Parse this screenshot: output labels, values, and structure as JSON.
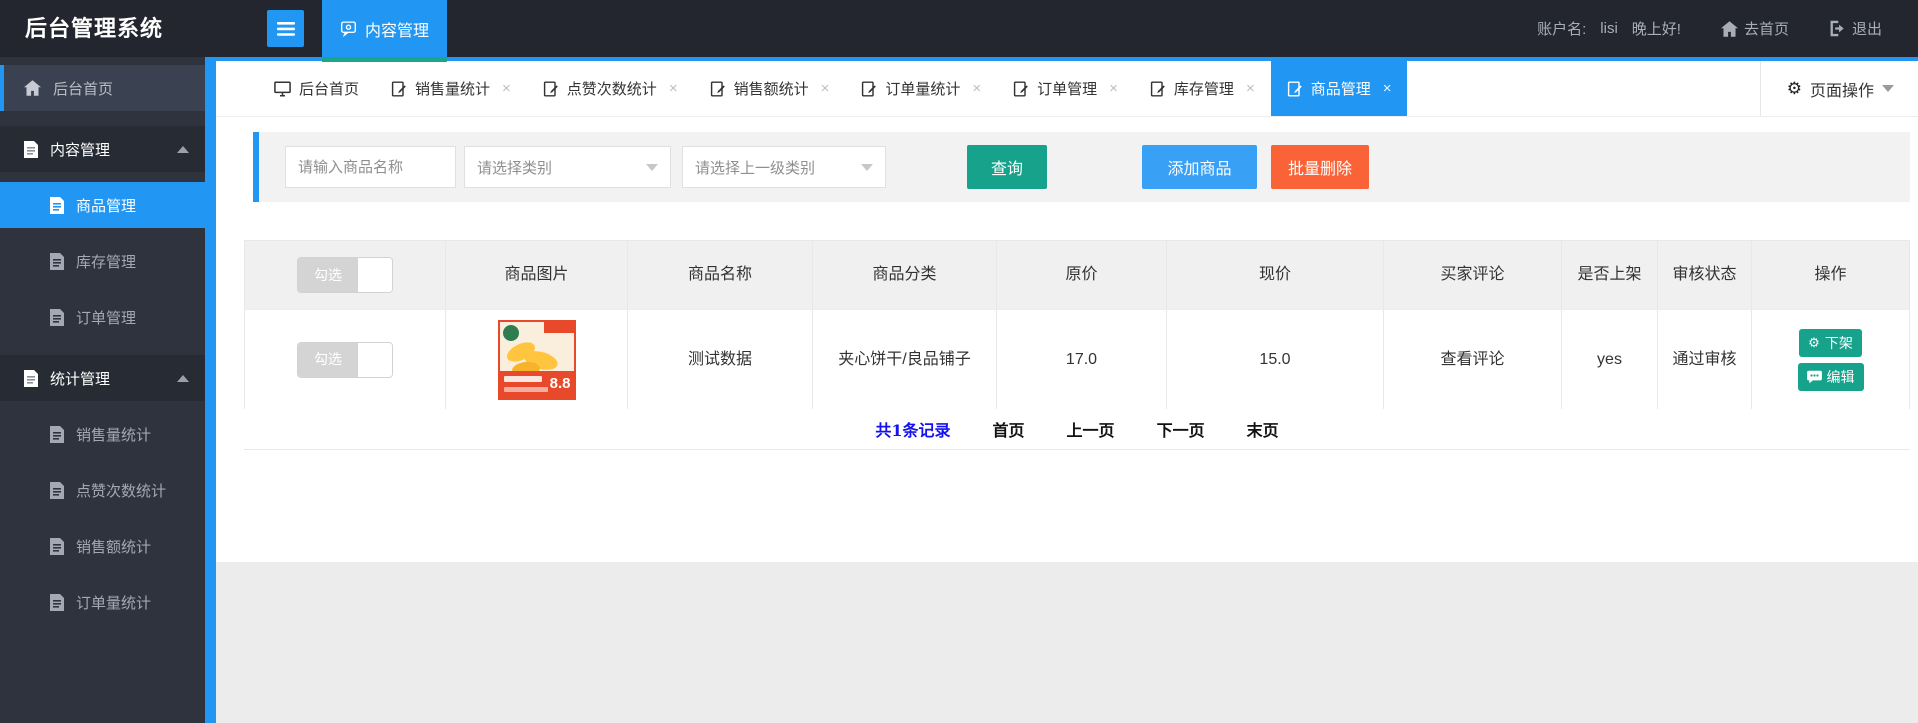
{
  "colors": {
    "accent_blue": "#2196F3",
    "teal": "#17A28B",
    "teal_underline": "#1AA58C",
    "orange_delete": "#FA6337",
    "topbar_bg": "#23262E",
    "sidebar_bg": "#2F333D",
    "pager_total_blue": "#1512F0"
  },
  "topbar": {
    "title": "后台管理系统",
    "module_tab": "内容管理",
    "account_label": "账户名:",
    "account_name": "lisi",
    "greeting": "晚上好!",
    "go_home": "去首页",
    "logout": "退出"
  },
  "sidebar": {
    "items": [
      {
        "label": "后台首页",
        "type": "home"
      },
      {
        "label": "内容管理",
        "type": "section"
      },
      {
        "label": "商品管理",
        "type": "child-active"
      },
      {
        "label": "库存管理",
        "type": "child"
      },
      {
        "label": "订单管理",
        "type": "child"
      },
      {
        "label": "统计管理",
        "type": "section"
      },
      {
        "label": "销售量统计",
        "type": "child"
      },
      {
        "label": "点赞次数统计",
        "type": "child"
      },
      {
        "label": "销售额统计",
        "type": "child"
      },
      {
        "label": "订单量统计",
        "type": "child"
      }
    ]
  },
  "tabbar": {
    "tabs": [
      {
        "label": "后台首页",
        "closable": false,
        "active": false
      },
      {
        "label": "销售量统计",
        "closable": true,
        "active": false
      },
      {
        "label": "点赞次数统计",
        "closable": true,
        "active": false
      },
      {
        "label": "销售额统计",
        "closable": true,
        "active": false
      },
      {
        "label": "订单量统计",
        "closable": true,
        "active": false
      },
      {
        "label": "订单管理",
        "closable": true,
        "active": false
      },
      {
        "label": "库存管理",
        "closable": true,
        "active": false
      },
      {
        "label": "商品管理",
        "closable": true,
        "active": true
      }
    ],
    "close_glyph": "×",
    "page_ops": "页面操作",
    "gear_glyph": "⚙"
  },
  "filters": {
    "name_placeholder": "请输入商品名称",
    "category_placeholder": "请选择类别",
    "parent_category_placeholder": "请选择上一级类别",
    "search_label": "查询",
    "add_label": "添加商品",
    "batch_delete_label": "批量删除"
  },
  "table": {
    "toggle_label": "勾选",
    "columns": {
      "image": "商品图片",
      "name": "商品名称",
      "category": "商品分类",
      "original_price": "原价",
      "current_price": "现价",
      "comments": "买家评论",
      "on_shelf": "是否上架",
      "audit": "审核状态",
      "actions": "操作"
    },
    "row": {
      "name": "测试数据",
      "category": "夹心饼干/良品铺子",
      "original_price": "17.0",
      "current_price": "15.0",
      "comments_link": "查看评论",
      "on_shelf": "yes",
      "audit": "通过审核",
      "off_shelf_label": "下架",
      "edit_label": "编辑",
      "image_price_badge": "8.8"
    }
  },
  "pagination": {
    "total": "共1条记录",
    "first": "首页",
    "prev": "上一页",
    "next": "下一页",
    "last": "末页"
  }
}
